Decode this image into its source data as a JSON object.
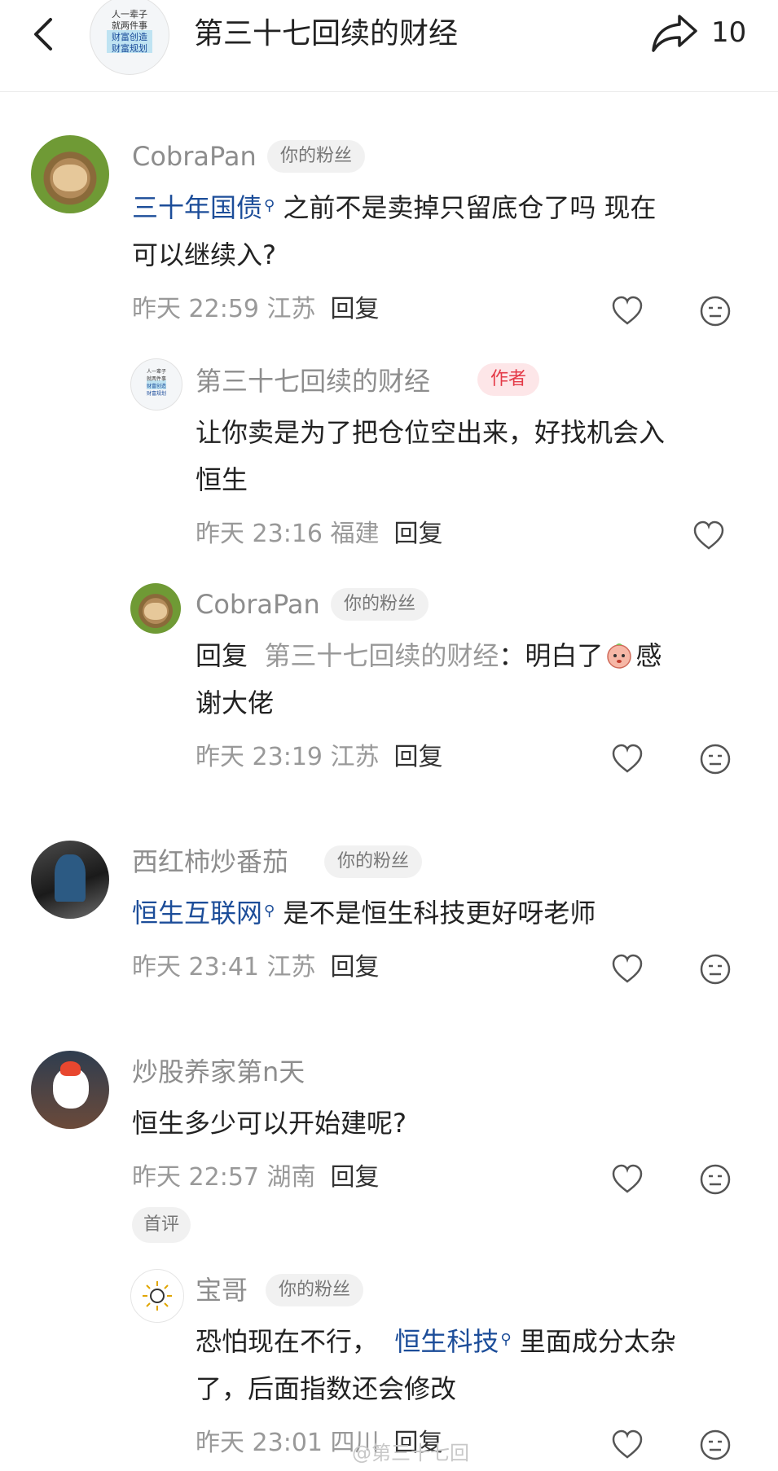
{
  "header": {
    "back_icon": "chevron-left-icon",
    "avatar_lines": [
      "人一辈子",
      "就两件事",
      "财富创造",
      "财富规划"
    ],
    "title": "第三十七回续的财经",
    "share_icon": "share-arrow-icon",
    "share_count": "10"
  },
  "comments": [
    {
      "name": "CobraPan",
      "badge": "你的粉丝",
      "link": "三十年国债",
      "text_line1": "之前不是卖掉只留底仓了吗 现在",
      "text_line2": "可以继续入?",
      "time": "昨天 22:59 江苏",
      "reply": "回复",
      "replies": [
        {
          "name": "第三十七回续的财经",
          "badge": "作者",
          "text_line1": "让你卖是为了把仓位空出来，好找机会入",
          "text_line2": "恒生",
          "time": "昨天 23:16 福建",
          "reply": "回复"
        },
        {
          "name": "CobraPan",
          "badge": "你的粉丝",
          "reply_prefix": "回复",
          "reply_target": "第三十七回续的财经",
          "text_line1": "：明白了",
          "text_line1_end": "感",
          "text_line2": "谢大佬",
          "time": "昨天 23:19 江苏",
          "reply": "回复"
        }
      ]
    },
    {
      "name": "西红柿炒番茄",
      "badge": "你的粉丝",
      "link": "恒生互联网",
      "text_line1": "是不是恒生科技更好呀老师",
      "time": "昨天 23:41 江苏",
      "reply": "回复"
    },
    {
      "name": "炒股养家第n天",
      "text_line1": "恒生多少可以开始建呢?",
      "time": "昨天 22:57 湖南",
      "reply": "回复",
      "first_tag": "首评",
      "replies": [
        {
          "name": "宝哥",
          "badge": "你的粉丝",
          "text_prefix": "恐怕现在不行，",
          "link": "恒生科技",
          "text_line1": "里面成分太杂",
          "text_line2": "了，后面指数还会修改",
          "time": "昨天 23:01 四川",
          "reply": "回复"
        }
      ]
    }
  ],
  "watermark": "@第三十七回"
}
